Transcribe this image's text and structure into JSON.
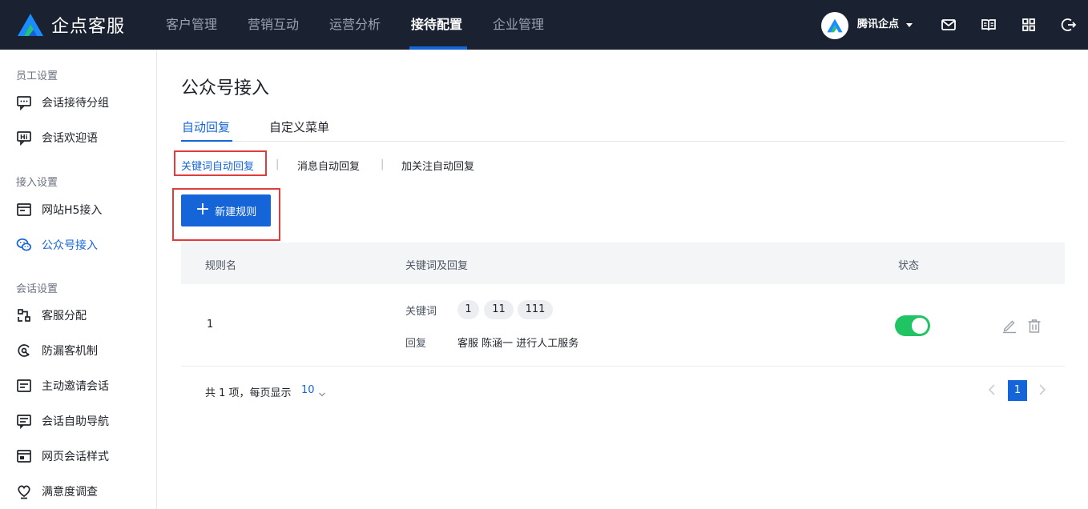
{
  "app": {
    "name": "企点客服"
  },
  "nav": {
    "items": [
      {
        "label": "客户管理"
      },
      {
        "label": "营销互动"
      },
      {
        "label": "运营分析"
      },
      {
        "label": "接待配置"
      },
      {
        "label": "企业管理"
      }
    ],
    "active_index": 3
  },
  "user": {
    "name": "腾讯企点"
  },
  "top_icons": [
    "mail-icon",
    "book-icon",
    "apps-grid-icon",
    "logout-icon"
  ],
  "sidebar": {
    "groups": [
      {
        "label": "员工设置"
      },
      {
        "label": "接入设置"
      },
      {
        "label": "会话设置"
      }
    ],
    "items": [
      {
        "label": "会话接待分组",
        "icon": "chat-group-icon"
      },
      {
        "label": "会话欢迎语",
        "icon": "welcome-message-icon"
      },
      {
        "label": "网站H5接入",
        "icon": "web-window-icon"
      },
      {
        "label": "公众号接入",
        "icon": "wechat-icon"
      },
      {
        "label": "客服分配",
        "icon": "assign-icon"
      },
      {
        "label": "防漏客机制",
        "icon": "anti-leak-icon"
      },
      {
        "label": "主动邀请会话",
        "icon": "invite-icon"
      },
      {
        "label": "会话自助导航",
        "icon": "navigation-icon"
      },
      {
        "label": "网页会话样式",
        "icon": "style-icon"
      },
      {
        "label": "满意度调查",
        "icon": "survey-icon"
      }
    ],
    "active_item": "公众号接入"
  },
  "page": {
    "title": "公众号接入",
    "tabs": [
      {
        "label": "自动回复"
      },
      {
        "label": "自定义菜单"
      }
    ],
    "subtabs": [
      {
        "label": "关键词自动回复"
      },
      {
        "label": "消息自动回复"
      },
      {
        "label": "加关注自动回复"
      }
    ],
    "subtab_separator": "|",
    "new_rule_button": "新建规则",
    "table": {
      "headers": {
        "name": "规则名",
        "keywords": "关键词及回复",
        "status": "状态"
      },
      "rows": [
        {
          "name": "1",
          "keyword_label": "关键词",
          "keywords": [
            "1",
            "11",
            "111"
          ],
          "reply_label": "回复",
          "reply": "客服 陈涵一 进行人工服务",
          "status_on": true
        }
      ]
    },
    "pagination": {
      "summary": "共 1 项，每页显示",
      "page_size": "10",
      "current_page": "1"
    }
  },
  "colors": {
    "topbar": "#1a2130",
    "accent": "#1665d8",
    "toggle_on": "#20c463",
    "highlight_box": "#e03c3c"
  }
}
